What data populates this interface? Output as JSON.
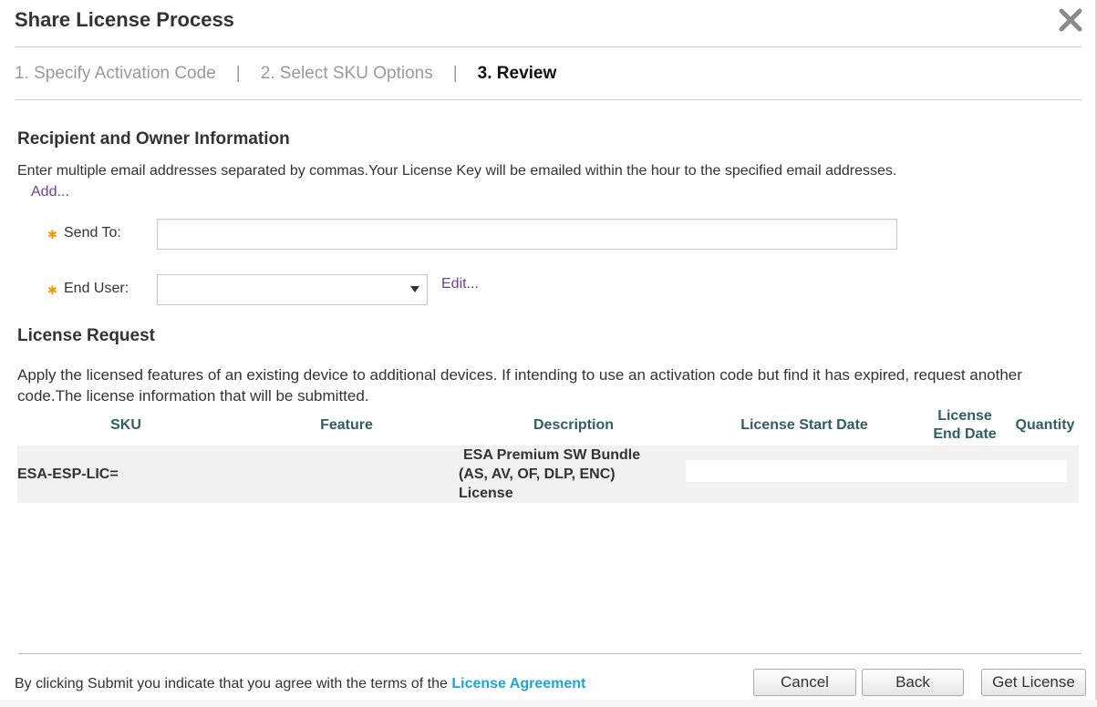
{
  "dialog": {
    "title": "Share License Process"
  },
  "steps": [
    {
      "label": "1. Specify Activation Code",
      "active": false
    },
    {
      "label": "2. Select SKU Options",
      "active": false
    },
    {
      "label": "3. Review",
      "active": true
    }
  ],
  "step_separator": "|",
  "recipient": {
    "title": "Recipient and Owner Information",
    "description": "Enter multiple email addresses separated by commas.Your License Key will be emailed within the hour to the specified email addresses.",
    "add_link": "Add...",
    "send_to_label": "Send To:",
    "send_to_value": "",
    "end_user_label": "End User:",
    "end_user_value": "",
    "edit_link": "Edit...",
    "required_marker": "✱"
  },
  "license_request": {
    "title": "License Request",
    "description": "Apply the licensed features of an existing device to additional devices. If intending to use an activation code but find it has expired, request another code.The license information that will be submitted.",
    "columns": {
      "sku": "SKU",
      "feature": "Feature",
      "description": "Description",
      "start_date": "License Start Date",
      "end_date_line1": "License",
      "end_date_line2": "End Date",
      "quantity": "Quantity"
    },
    "rows": [
      {
        "sku": "ESA-ESP-LIC=",
        "feature": "",
        "description_line1": "ESA Premium SW Bundle",
        "description_line2": "(AS, AV, OF, DLP, ENC)",
        "description_line3": "License"
      }
    ]
  },
  "footer": {
    "agreement_text": "By clicking Submit you indicate that you agree with the terms of the ",
    "agreement_link": "License Agreement",
    "cancel_label": "Cancel",
    "back_label": "Back",
    "get_license_label": "Get License"
  },
  "colors": {
    "accent_link": "#1aa7d8",
    "purple_link": "#6c3f99",
    "required": "#f39a00",
    "table_header": "#2f5f5f"
  }
}
